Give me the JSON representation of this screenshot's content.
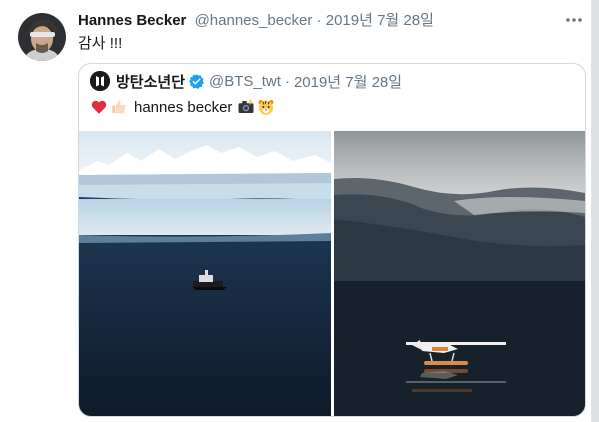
{
  "tweet": {
    "author_name": "Hannes Becker",
    "author_handle": "@hannes_becker",
    "separator": "·",
    "date": "2019년 7월 28일",
    "text": "감사 !!!"
  },
  "quoted_tweet": {
    "author_name": "방탄소년단",
    "author_handle": "@BTS_twt",
    "separator": "·",
    "date": "2019년 7월 28일",
    "text": "hannes becker",
    "emoji_before": [
      "red-heart",
      "thumbs-up"
    ],
    "emoji_after": [
      "camera-with-flash",
      "tiger-face"
    ]
  },
  "icons": {
    "more": "more-horizontal-icon",
    "verified": "verified-badge-icon"
  },
  "colors": {
    "name_text": "#14171a",
    "secondary_text": "#657786",
    "verified_blue": "#1da1f2",
    "border": "#cfd9de"
  }
}
